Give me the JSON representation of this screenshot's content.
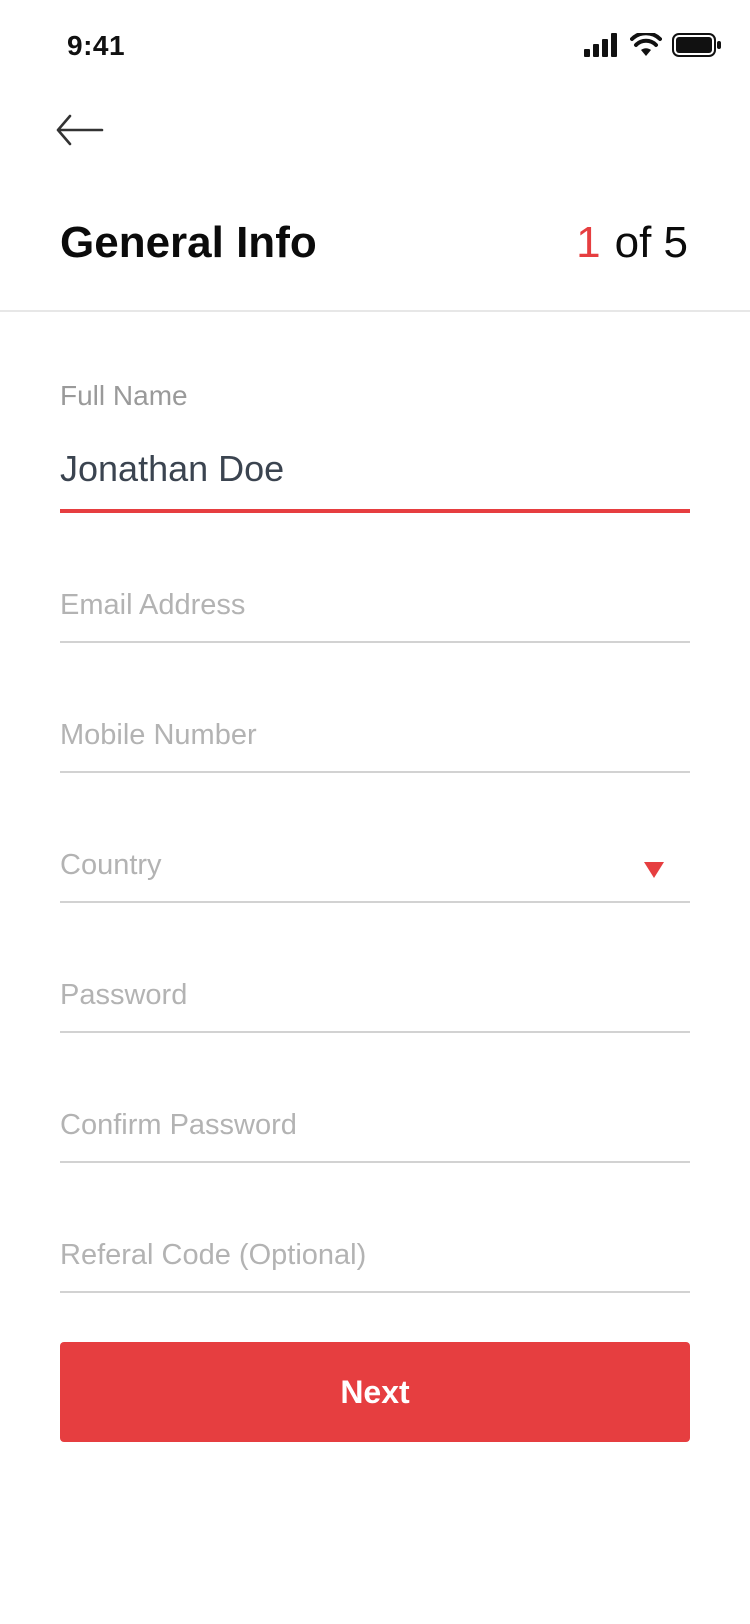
{
  "status_bar": {
    "time": "9:41",
    "icons": [
      "signal-icon",
      "wifi-icon",
      "battery-icon"
    ]
  },
  "header": {
    "back_icon": "arrow-left-icon",
    "title": "General Info",
    "step_current": "1",
    "step_total_text": "of 5"
  },
  "form": {
    "full_name_label": "Full Name",
    "full_name_value": "Jonathan Doe",
    "email_placeholder": "Email Address",
    "mobile_placeholder": "Mobile Number",
    "country_placeholder": "Country",
    "country_dropdown_icon": "triangle-down-icon",
    "password_placeholder": "Password",
    "confirm_password_placeholder": "Confirm Password",
    "referal_code_placeholder": "Referal Code (Optional)"
  },
  "actions": {
    "next_label": "Next"
  },
  "colors": {
    "accent": "#e63e40",
    "title": "#0b0b0b",
    "value": "#3b4450",
    "placeholder": "#b3b3b3",
    "label": "#9a9a9a",
    "underline": "#d2d2d2"
  }
}
